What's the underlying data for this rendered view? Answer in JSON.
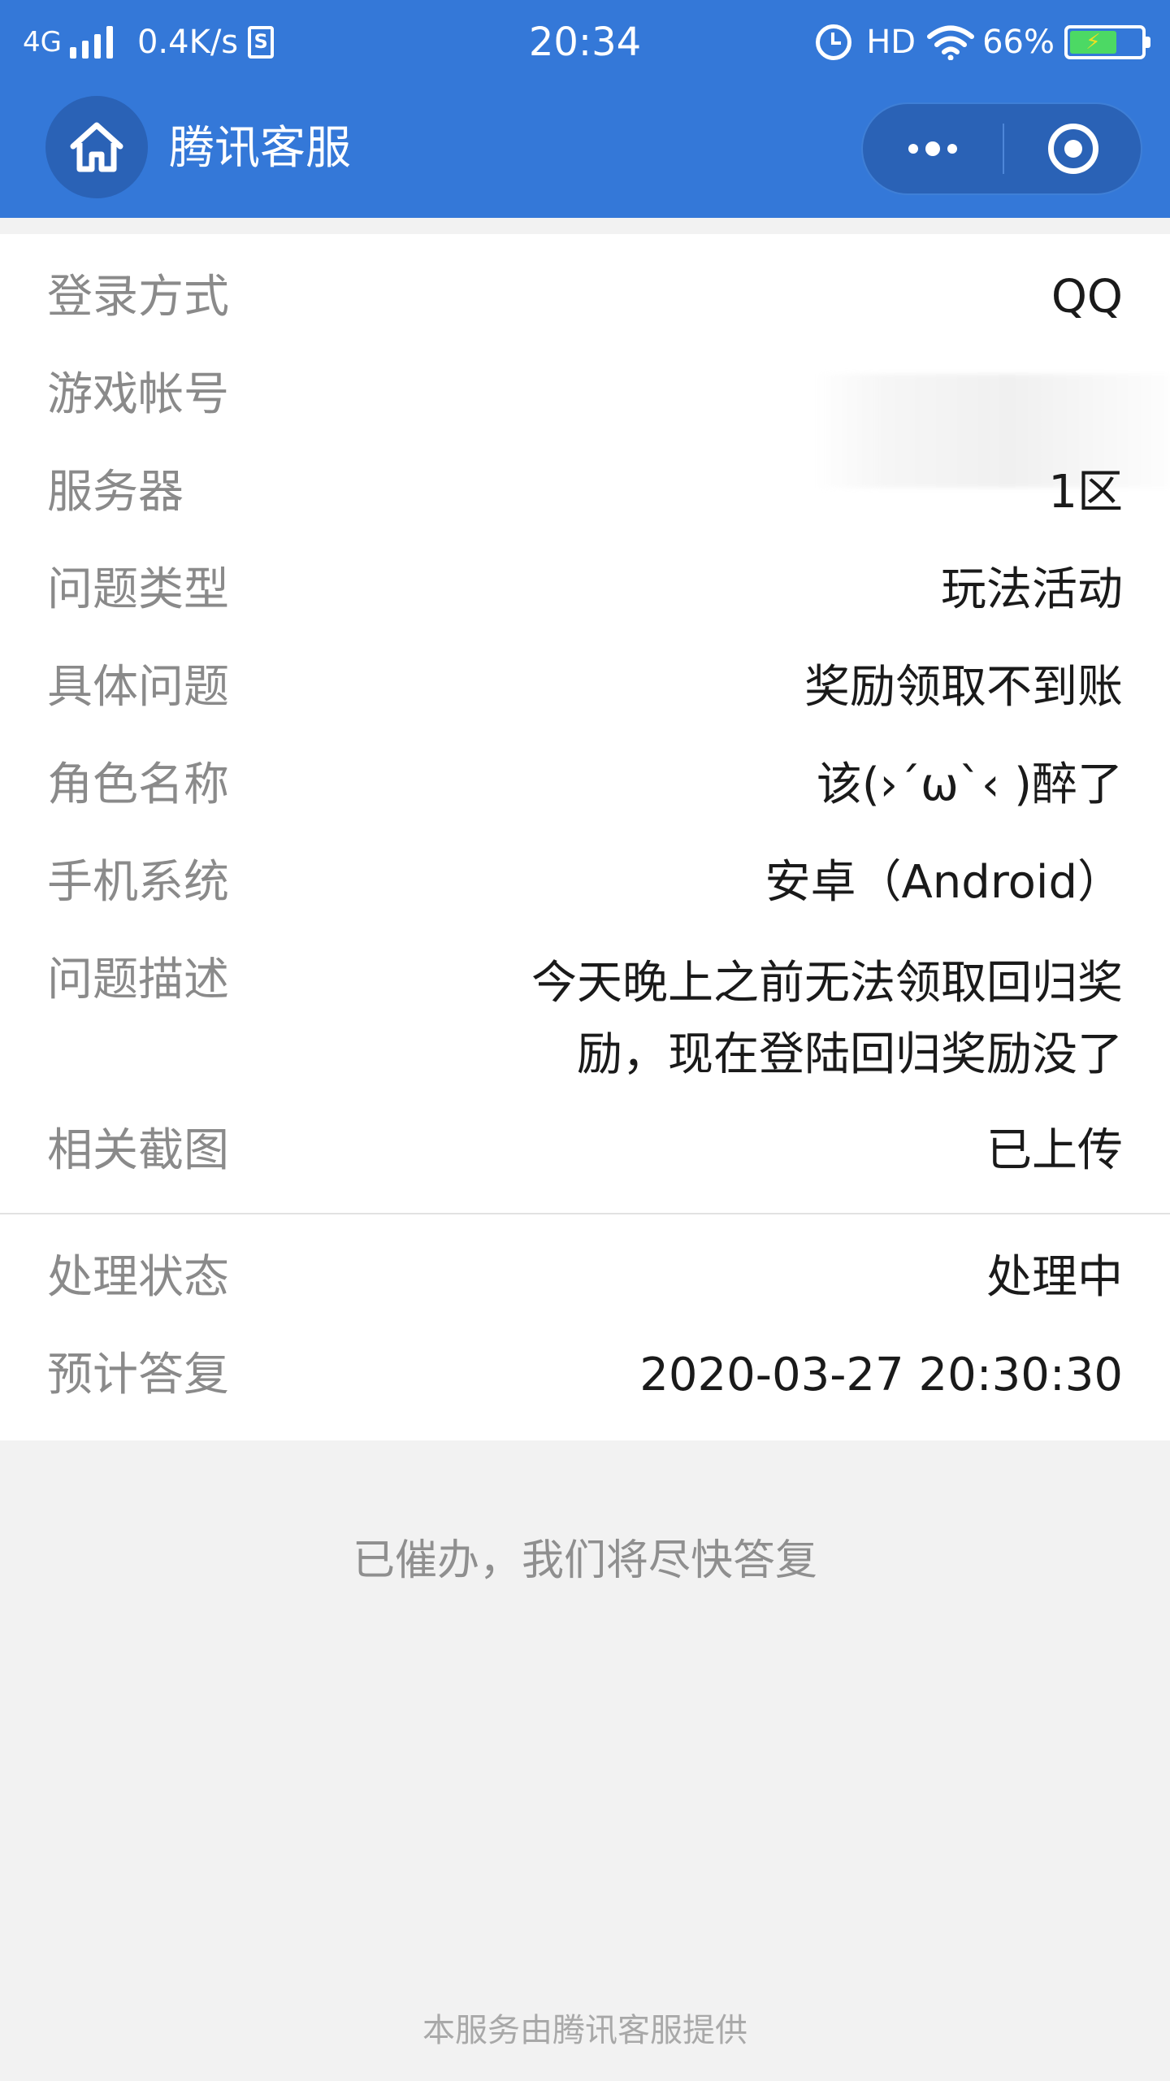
{
  "status_bar": {
    "network_type": "4G",
    "net_speed": "0.4K/s",
    "sim_icon_text": "S",
    "time": "20:34",
    "hd": "HD",
    "battery_percent": "66%",
    "battery_level": 0.66,
    "icons": [
      "signal-icon",
      "sim-icon",
      "alarm-icon",
      "wifi-icon",
      "battery-icon"
    ]
  },
  "nav": {
    "title": "腾讯客服",
    "home_icon": "home-icon",
    "more_icon": "more-dots-icon",
    "close_icon": "target-icon"
  },
  "details": {
    "login_method": {
      "label": "登录方式",
      "value": "QQ"
    },
    "game_account": {
      "label": "游戏帐号",
      "value": ""
    },
    "server": {
      "label": "服务器",
      "value": "1区"
    },
    "issue_type": {
      "label": "问题类型",
      "value": "玩法活动"
    },
    "specific_issue": {
      "label": "具体问题",
      "value": "奖励领取不到账"
    },
    "character_name": {
      "label": "角色名称",
      "value": "该(›´ω`‹ )醉了"
    },
    "phone_system": {
      "label": "手机系统",
      "value": "安卓（Android）"
    },
    "description": {
      "label": "问题描述",
      "value": "今天晚上之前无法领取回归奖励，现在登陆回归奖励没了"
    },
    "screenshots": {
      "label": "相关截图",
      "value": "已上传"
    }
  },
  "status": {
    "processing_status": {
      "label": "处理状态",
      "value": "处理中"
    },
    "expected_reply": {
      "label": "预计答复",
      "value": "2020-03-27 20:30:30"
    }
  },
  "urge_message": "已催办，我们将尽快答复",
  "footer": "本服务由腾讯客服提供",
  "colors": {
    "header_bg": "#3478d8",
    "capsule_bg": "#2a62b6",
    "label_text": "#8a8a8a",
    "value_text": "#1a1a1a",
    "page_bg": "#f2f2f2"
  }
}
